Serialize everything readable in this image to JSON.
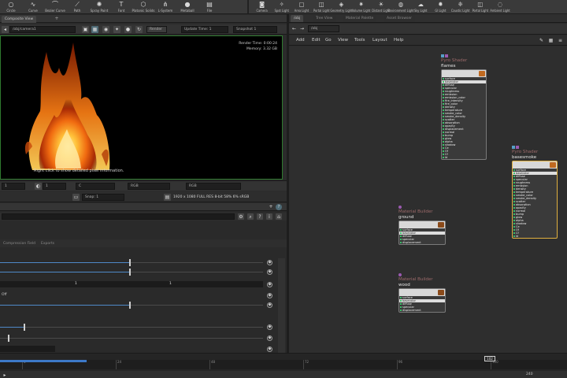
{
  "shelf": {
    "left_tools": [
      {
        "icon": "circle-icon",
        "label": "Circle"
      },
      {
        "icon": "curve-icon",
        "label": "Curve"
      },
      {
        "icon": "bezier-icon",
        "label": "Bezier Curve"
      },
      {
        "icon": "path-icon",
        "label": "Path"
      },
      {
        "icon": "spray-icon",
        "label": "Spray Paint"
      },
      {
        "icon": "text-icon",
        "label": "Font"
      },
      {
        "icon": "platonic-icon",
        "label": "Platonic Solids"
      },
      {
        "icon": "lsystem-icon",
        "label": "L-System"
      },
      {
        "icon": "metaball-icon",
        "label": "Metaball"
      },
      {
        "icon": "file-icon",
        "label": "File"
      }
    ],
    "right_tools": [
      {
        "icon": "camera-icon",
        "label": "Camera"
      },
      {
        "icon": "spot-light-icon",
        "label": "Spot Light"
      },
      {
        "icon": "area-light-icon",
        "label": "Area Light"
      },
      {
        "icon": "portal-light-icon",
        "label": "Portal Light"
      },
      {
        "icon": "geometry-light-icon",
        "label": "Geometry Light"
      },
      {
        "icon": "volume-light-icon",
        "label": "Volume Light"
      },
      {
        "icon": "distant-light-icon",
        "label": "Distant Light"
      },
      {
        "icon": "environment-light-icon",
        "label": "Environment Light"
      },
      {
        "icon": "sky-light-icon",
        "label": "Sky Light"
      },
      {
        "icon": "gi-light-icon",
        "label": "GI Light"
      },
      {
        "icon": "caustic-light-icon",
        "label": "Caustic Light"
      },
      {
        "icon": "portal-light-icon",
        "label": "Portal Light"
      },
      {
        "icon": "ambient-light-icon",
        "label": "Ambient Light"
      }
    ]
  },
  "left_tabs": [
    {
      "label": "Composite View"
    }
  ],
  "viewbar": {
    "camera_value": "/obj/camera1",
    "render_label": "Render",
    "update_label": "Update Time: 1",
    "snapshot_label": "Snapshot 1"
  },
  "render": {
    "stats_line1": "Render Time: 0:00:24",
    "stats_line2": "Memory:    3.32 GB",
    "hint": "Right click to show detailed pixel information."
  },
  "render_bar": {
    "frame_value": "1",
    "zoom_value": "1",
    "channel_value": "C",
    "mode_value": "RGB",
    "snap_label": "Snap: 1",
    "status": "1920 x 1080 FULL RES 8-bit  58% 6%  sRGB"
  },
  "params": {
    "tabs": [
      {
        "label": "Compression Field"
      },
      {
        "label": "Exports"
      }
    ],
    "row_values": [
      {
        "a": "1",
        "b": "1"
      }
    ],
    "off_label": "Off"
  },
  "network": {
    "tabs": [
      {
        "label": "/obj"
      },
      {
        "label": "Tree View"
      },
      {
        "label": "Material Palette"
      },
      {
        "label": "Asset Browser"
      }
    ],
    "path": "/obj",
    "menu": [
      {
        "label": "Add"
      },
      {
        "label": "Edit"
      },
      {
        "label": "Go"
      },
      {
        "label": "View"
      },
      {
        "label": "Tools"
      },
      {
        "label": "Layout"
      },
      {
        "label": "Help"
      }
    ],
    "nodes": [
      {
        "type": "Pyro Shader",
        "name": "flames",
        "lines": [
          "surface",
          "basecolor",
          "diffuse",
          "specular",
          "roughness",
          "emission",
          "emission_color",
          "fire_intensity",
          "fire_color",
          "density",
          "temperature",
          "smoke_color",
          "smoke_density",
          "scatter",
          "absorption",
          "opacity",
          "displacement",
          "normal",
          "bump",
          "glow",
          "alpha",
          "shadow",
          "Ce",
          "Of",
          "Cf",
          "Id"
        ]
      },
      {
        "type": "Pyro Shader",
        "name": "basesmoke",
        "lines": [
          "surface",
          "basecolor",
          "diffuse",
          "specular",
          "roughness",
          "emission",
          "density",
          "temperature",
          "smoke_color",
          "smoke_density",
          "scatter",
          "absorption",
          "opacity",
          "normal",
          "bump",
          "glow",
          "alpha",
          "shadow",
          "Ce",
          "Of",
          "Cf",
          "Id"
        ]
      },
      {
        "type": "Material Builder",
        "name": "ground",
        "lines": [
          "surface",
          "basecolor",
          "diffuse",
          "specular",
          "displacement"
        ]
      },
      {
        "type": "Material Builder",
        "name": "wood",
        "lines": [
          "surface",
          "basecolor",
          "diffuse",
          "specular",
          "displacement"
        ]
      }
    ]
  },
  "timeline": {
    "ticks": [
      "1",
      "24",
      "48",
      "72",
      "96",
      "120"
    ],
    "marker": "102",
    "end_label": "240"
  },
  "colors": {
    "accent": "#4f89c8",
    "selected": "#e0b040",
    "render_border": "#2f7a2f"
  }
}
